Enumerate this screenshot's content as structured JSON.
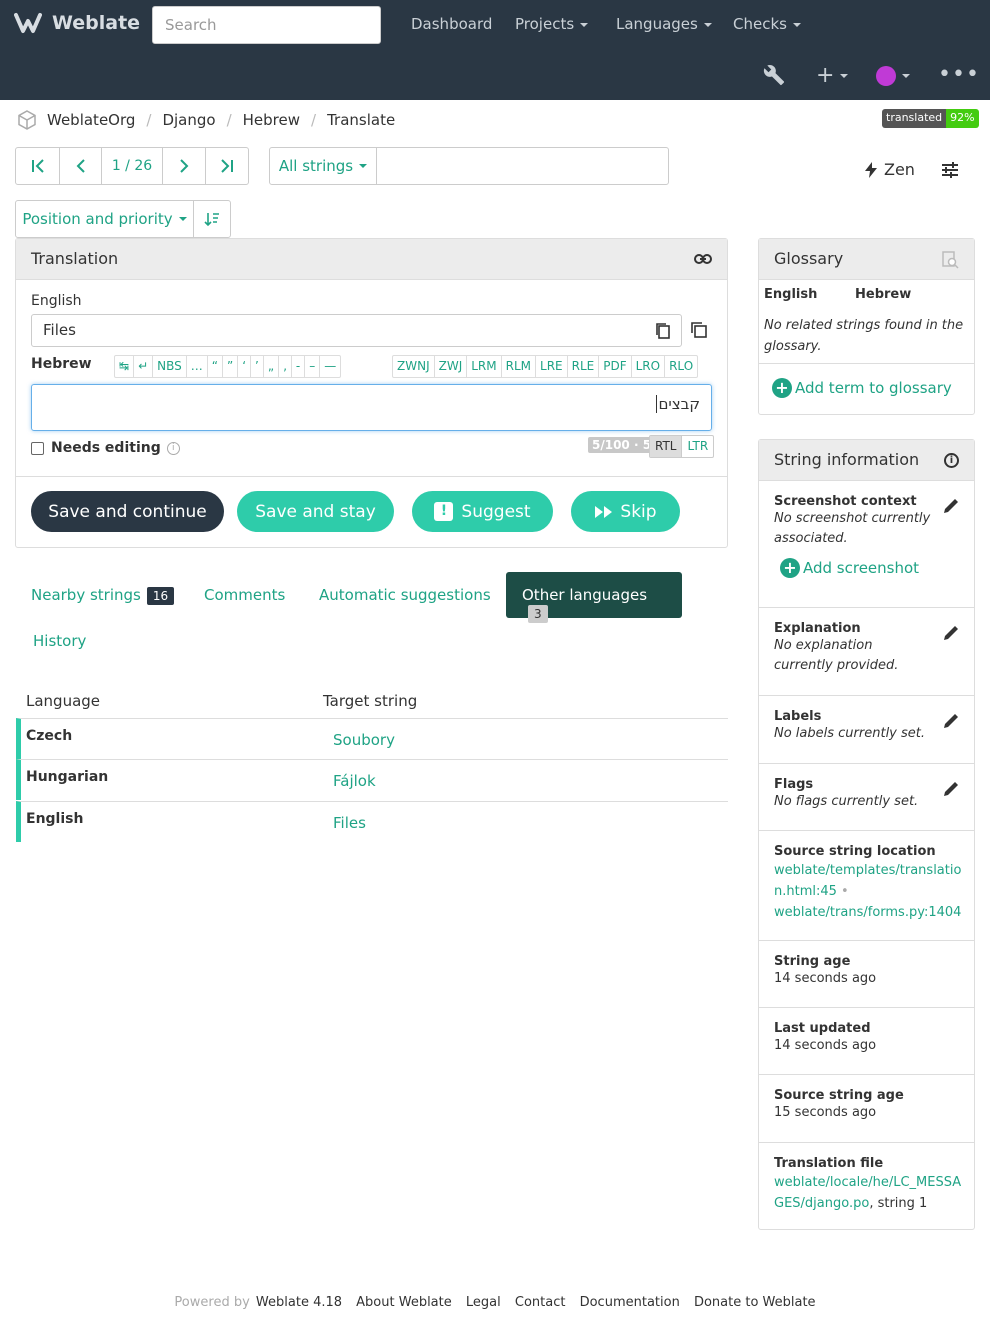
{
  "nav": {
    "brand": "Weblate",
    "search_placeholder": "Search",
    "items": [
      "Dashboard",
      "Projects",
      "Languages",
      "Checks"
    ]
  },
  "breadcrumb": [
    "WeblateOrg",
    "Django",
    "Hebrew",
    "Translate"
  ],
  "badge": {
    "label": "translated",
    "value": "92%"
  },
  "pager": {
    "position": "1 / 26"
  },
  "filter": {
    "label": "All strings",
    "query": ""
  },
  "zen": "Zen",
  "sort": {
    "label": "Position and priority"
  },
  "translation": {
    "title": "Translation",
    "source_lang": "English",
    "source_text": "Files",
    "target_lang": "Hebrew",
    "specials": [
      "↹",
      "↵",
      "NBS",
      "…",
      "“",
      "”",
      "‘",
      "’",
      "„",
      "‚",
      "-",
      "–",
      "—"
    ],
    "controls": [
      "ZWNJ",
      "ZWJ",
      "LRM",
      "RLM",
      "LRE",
      "RLE",
      "PDF",
      "LRO",
      "RLO"
    ],
    "target_text": "קבצים",
    "needs_editing": "Needs editing",
    "counter": "5/100 · 5",
    "dir_rtl": "RTL",
    "dir_ltr": "LTR",
    "buttons": {
      "save_continue": "Save and continue",
      "save_stay": "Save and stay",
      "suggest": "Suggest",
      "skip": "Skip"
    }
  },
  "tabs": [
    {
      "label": "Nearby strings",
      "count": "16"
    },
    {
      "label": "Comments"
    },
    {
      "label": "Automatic suggestions"
    },
    {
      "label": "Other languages",
      "count": "3"
    },
    {
      "label": "History"
    }
  ],
  "other_languages": {
    "headers": [
      "Language",
      "Target string"
    ],
    "rows": [
      {
        "lang": "Czech",
        "text": "Soubory"
      },
      {
        "lang": "Hungarian",
        "text": "Fájlok"
      },
      {
        "lang": "English",
        "text": "Files"
      }
    ]
  },
  "glossary": {
    "title": "Glossary",
    "col_source": "English",
    "col_target": "Hebrew",
    "empty": "No related strings found in the glossary.",
    "add": "Add term to glossary"
  },
  "string_info": {
    "title": "String information",
    "screenshot": {
      "title": "Screenshot context",
      "text": "No screenshot currently associated.",
      "add": "Add screenshot"
    },
    "explanation": {
      "title": "Explanation",
      "text": "No explanation currently provided."
    },
    "labels": {
      "title": "Labels",
      "text": "No labels currently set."
    },
    "flags": {
      "title": "Flags",
      "text": "No flags currently set."
    },
    "location": {
      "title": "Source string location",
      "link1": "weblate/templates/translation.html:45",
      "sep": "•",
      "link2": "weblate/trans/forms.py:1404"
    },
    "age": {
      "title": "String age",
      "text": "14 seconds ago"
    },
    "updated": {
      "title": "Last updated",
      "text": "14 seconds ago"
    },
    "source_age": {
      "title": "Source string age",
      "text": "15 seconds ago"
    },
    "file": {
      "title": "Translation file",
      "link": "weblate/locale/he/LC_MESSAGES/django.po",
      "suffix": ", string 1"
    }
  },
  "footer": {
    "powered": "Powered by",
    "version": "Weblate 4.18",
    "links": [
      "About Weblate",
      "Legal",
      "Contact",
      "Documentation",
      "Donate to Weblate"
    ]
  },
  "colors": {
    "navbar": "#2a3744",
    "accent": "#1fa385",
    "button_teal": "#2eccaa"
  }
}
